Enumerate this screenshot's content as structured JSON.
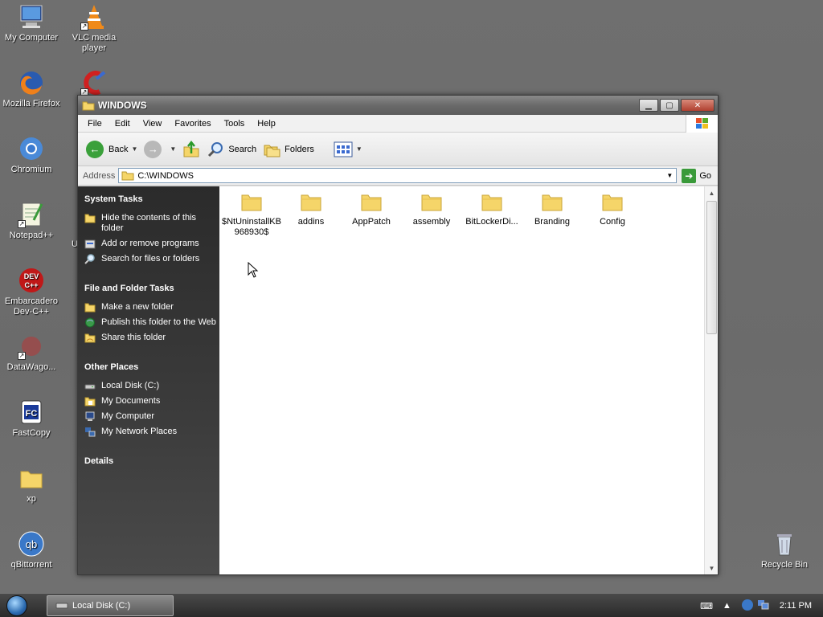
{
  "desktop": {
    "icons": [
      {
        "label": "My Computer"
      },
      {
        "label": "VLC media player"
      },
      {
        "label": "Mozilla Firefox"
      },
      {
        "label": "Chromium"
      },
      {
        "label": "Notepad++"
      },
      {
        "label": "Embarcadero Dev-C++"
      },
      {
        "label": "DataWago..."
      },
      {
        "label": "FastCopy"
      },
      {
        "label": "xp"
      },
      {
        "label": "qBittorrent"
      },
      {
        "label": "Recycle Bin"
      }
    ],
    "partial_label": "U"
  },
  "window": {
    "title": "WINDOWS",
    "menu": [
      "File",
      "Edit",
      "View",
      "Favorites",
      "Tools",
      "Help"
    ],
    "toolbar": {
      "back": "Back",
      "search": "Search",
      "folders": "Folders"
    },
    "address": {
      "label": "Address",
      "value": "C:\\WINDOWS",
      "go": "Go"
    },
    "taskpane": {
      "system_tasks": {
        "title": "System Tasks",
        "items": [
          "Hide the contents of this folder",
          "Add or remove programs",
          "Search for files or folders"
        ]
      },
      "file_folder_tasks": {
        "title": "File and Folder Tasks",
        "items": [
          "Make a new folder",
          "Publish this folder to the Web",
          "Share this folder"
        ]
      },
      "other_places": {
        "title": "Other Places",
        "items": [
          "Local Disk (C:)",
          "My Documents",
          "My Computer",
          "My Network Places"
        ]
      },
      "details": {
        "title": "Details"
      }
    },
    "folders": [
      "$NtUninstallKB968930$",
      "addins",
      "AppPatch",
      "assembly",
      "BitLockerDi...",
      "Branding",
      "Config"
    ]
  },
  "taskbar": {
    "task_button": "Local Disk (C:)",
    "clock": "2:11 PM"
  },
  "colors": {
    "desktop": "#6e6e6e",
    "taskpane": "#333333",
    "folder": "#f5d569"
  }
}
